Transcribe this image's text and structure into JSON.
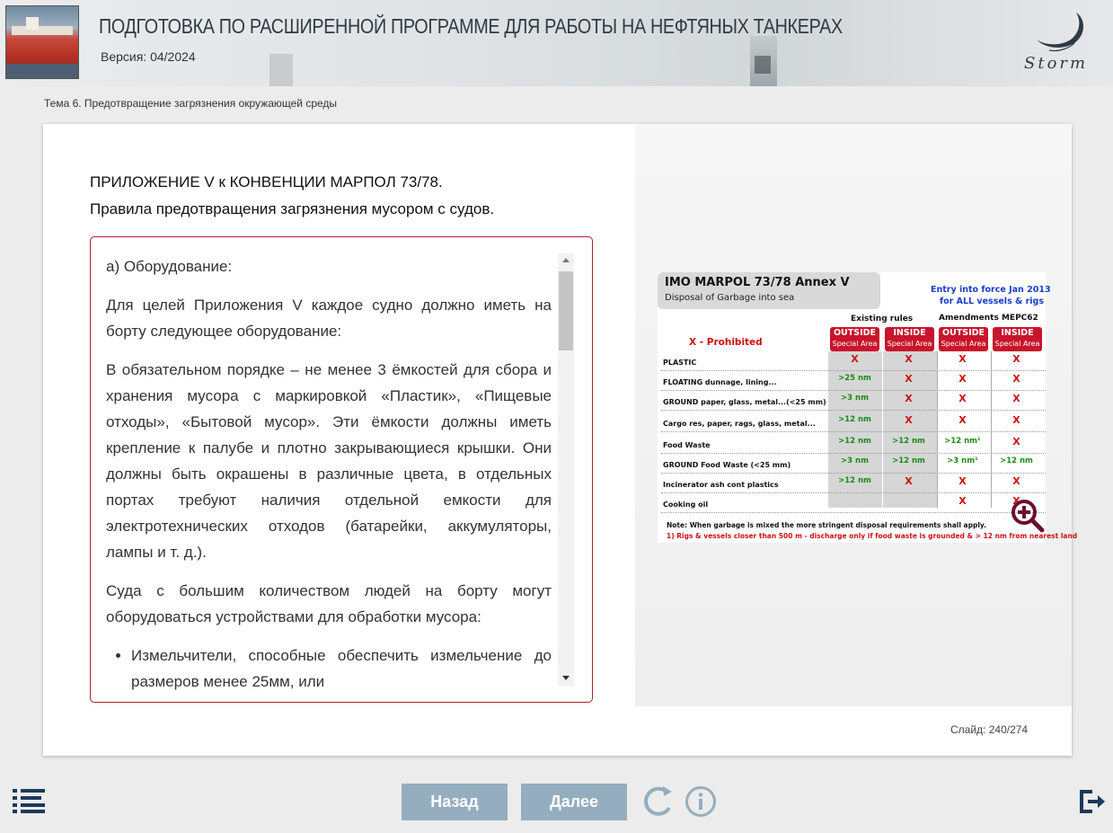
{
  "header": {
    "title": "ПОДГОТОВКА ПО РАСШИРЕННОЙ ПРОГРАММЕ ДЛЯ РАБОТЫ НА НЕФТЯНЫХ ТАНКЕРАХ",
    "version": "Версия: 04/2024",
    "logo_text": "Storm"
  },
  "breadcrumb": "Тема 6. Предотвращение загрязнения окружающей среды",
  "content": {
    "heading1": "ПРИЛОЖЕНИЕ V к КОНВЕНЦИИ МАРПОЛ 73/78.",
    "heading2": "Правила предотвращения загрязнения мусором с судов.",
    "section_title": "а) Оборудование:",
    "paragraphs": [
      "Для целей Приложения V каждое судно должно иметь на борту следующее оборудование:",
      "В обязательном порядке – не менее 3 ёмкостей для сбора и хранения мусора с маркировкой «Пластик», «Пищевые отходы», «Бытовой мусор». Эти ёмкости должны иметь крепление к палубе и плотно закрывающиеся крышки. Они должны быть окрашены в различные цвета, в отдельных портах требуют наличия отдельной емкости для электротехнических отходов (батарейки, аккумуляторы, лампы и т. д.).",
      "Суда с большим количеством людей на борту могут оборудоваться устройствами для обработки мусора:"
    ],
    "bullets": [
      "Измельчители, способные обеспечить измельчение до размеров менее 25мм, или"
    ]
  },
  "figure": {
    "title": "IMO MARPOL 73/78 Annex V",
    "subtitle": "Disposal of Garbage into sea",
    "entry_line1": "Entry into force Jan 2013",
    "entry_line2": "for ALL vessels & rigs",
    "existing_rules": "Existing rules",
    "amendments": "Amendments MEPC62",
    "prohibited": "X - Prohibited",
    "col_headers": [
      {
        "a": "OUTSIDE",
        "b": "Special Area"
      },
      {
        "a": "INSIDE",
        "b": "Special Area"
      },
      {
        "a": "OUTSIDE",
        "b": "Special Area"
      },
      {
        "a": "INSIDE",
        "b": "Special Area"
      }
    ],
    "rows": [
      {
        "label": "PLASTIC",
        "cells": [
          "X",
          "X",
          "X",
          "X"
        ]
      },
      {
        "label": "FLOATING dunnage, lining...",
        "cells": [
          ">25 nm",
          "X",
          "X",
          "X"
        ]
      },
      {
        "label": "GROUND paper, glass, metal...(<25 mm)",
        "cells": [
          ">3 nm",
          "X",
          "X",
          "X"
        ]
      },
      {
        "label": "Cargo res, paper, rags, glass, metal...",
        "cells": [
          ">12 nm",
          "X",
          "X",
          "X"
        ]
      },
      {
        "label": "Food Waste",
        "cells": [
          ">12 nm",
          ">12 nm",
          ">12 nm¹",
          "X"
        ]
      },
      {
        "label": "GROUND Food Waste        (<25 mm)",
        "cells": [
          ">3 nm",
          ">12 nm",
          ">3 nm¹",
          ">12 nm"
        ]
      },
      {
        "label": "Incinerator ash cont plastics",
        "cells": [
          ">12 nm",
          "X",
          "X",
          "X"
        ]
      },
      {
        "label": "Cooking oil",
        "cells": [
          "",
          "",
          "X",
          "X"
        ]
      }
    ],
    "note": "Note: When garbage is mixed the more stringent disposal requirements shall apply.",
    "footnote": "1) Rigs & vessels closer than 500 m - discharge only if food waste is grounded & > 12 nm from nearest land"
  },
  "slide_counter": "Слайд:  240/274",
  "nav": {
    "back_label": "Назад",
    "next_label": "Далее"
  },
  "colors": {
    "accent_red": "#b01e2a",
    "nav_button": "#94aebf",
    "icon_blue": "#1d3a5a"
  }
}
